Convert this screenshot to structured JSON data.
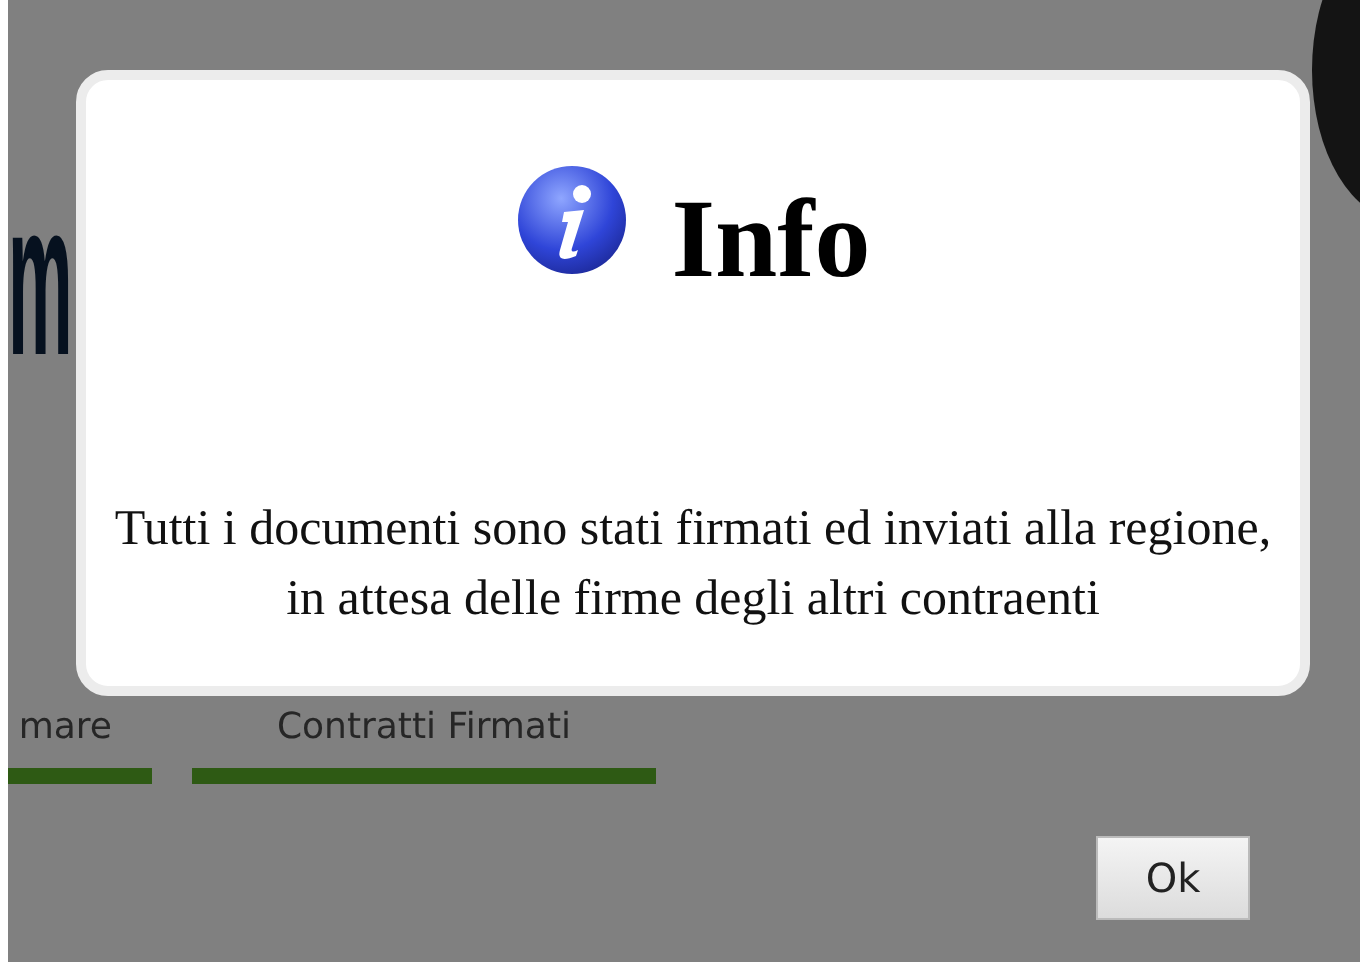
{
  "background": {
    "heading_fragment": "m",
    "tabs": [
      {
        "label": "mare"
      },
      {
        "label": "Contratti Firmati"
      }
    ]
  },
  "dialog": {
    "title": "Info",
    "message": "Tutti i documenti sono stati firmati ed inviati alla regione, in attesa delle firme degli altri contraenti",
    "buttons": [
      "Ok"
    ]
  }
}
